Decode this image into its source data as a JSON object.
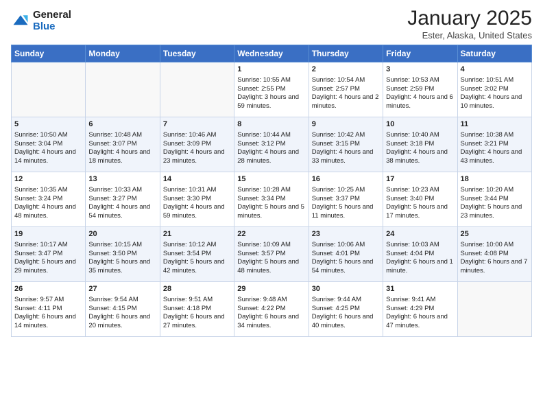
{
  "header": {
    "logo_general": "General",
    "logo_blue": "Blue",
    "title": "January 2025",
    "subtitle": "Ester, Alaska, United States"
  },
  "days_of_week": [
    "Sunday",
    "Monday",
    "Tuesday",
    "Wednesday",
    "Thursday",
    "Friday",
    "Saturday"
  ],
  "weeks": [
    [
      {
        "day": "",
        "info": ""
      },
      {
        "day": "",
        "info": ""
      },
      {
        "day": "",
        "info": ""
      },
      {
        "day": "1",
        "info": "Sunrise: 10:55 AM\nSunset: 2:55 PM\nDaylight: 3 hours and 59 minutes."
      },
      {
        "day": "2",
        "info": "Sunrise: 10:54 AM\nSunset: 2:57 PM\nDaylight: 4 hours and 2 minutes."
      },
      {
        "day": "3",
        "info": "Sunrise: 10:53 AM\nSunset: 2:59 PM\nDaylight: 4 hours and 6 minutes."
      },
      {
        "day": "4",
        "info": "Sunrise: 10:51 AM\nSunset: 3:02 PM\nDaylight: 4 hours and 10 minutes."
      }
    ],
    [
      {
        "day": "5",
        "info": "Sunrise: 10:50 AM\nSunset: 3:04 PM\nDaylight: 4 hours and 14 minutes."
      },
      {
        "day": "6",
        "info": "Sunrise: 10:48 AM\nSunset: 3:07 PM\nDaylight: 4 hours and 18 minutes."
      },
      {
        "day": "7",
        "info": "Sunrise: 10:46 AM\nSunset: 3:09 PM\nDaylight: 4 hours and 23 minutes."
      },
      {
        "day": "8",
        "info": "Sunrise: 10:44 AM\nSunset: 3:12 PM\nDaylight: 4 hours and 28 minutes."
      },
      {
        "day": "9",
        "info": "Sunrise: 10:42 AM\nSunset: 3:15 PM\nDaylight: 4 hours and 33 minutes."
      },
      {
        "day": "10",
        "info": "Sunrise: 10:40 AM\nSunset: 3:18 PM\nDaylight: 4 hours and 38 minutes."
      },
      {
        "day": "11",
        "info": "Sunrise: 10:38 AM\nSunset: 3:21 PM\nDaylight: 4 hours and 43 minutes."
      }
    ],
    [
      {
        "day": "12",
        "info": "Sunrise: 10:35 AM\nSunset: 3:24 PM\nDaylight: 4 hours and 48 minutes."
      },
      {
        "day": "13",
        "info": "Sunrise: 10:33 AM\nSunset: 3:27 PM\nDaylight: 4 hours and 54 minutes."
      },
      {
        "day": "14",
        "info": "Sunrise: 10:31 AM\nSunset: 3:30 PM\nDaylight: 4 hours and 59 minutes."
      },
      {
        "day": "15",
        "info": "Sunrise: 10:28 AM\nSunset: 3:34 PM\nDaylight: 5 hours and 5 minutes."
      },
      {
        "day": "16",
        "info": "Sunrise: 10:25 AM\nSunset: 3:37 PM\nDaylight: 5 hours and 11 minutes."
      },
      {
        "day": "17",
        "info": "Sunrise: 10:23 AM\nSunset: 3:40 PM\nDaylight: 5 hours and 17 minutes."
      },
      {
        "day": "18",
        "info": "Sunrise: 10:20 AM\nSunset: 3:44 PM\nDaylight: 5 hours and 23 minutes."
      }
    ],
    [
      {
        "day": "19",
        "info": "Sunrise: 10:17 AM\nSunset: 3:47 PM\nDaylight: 5 hours and 29 minutes."
      },
      {
        "day": "20",
        "info": "Sunrise: 10:15 AM\nSunset: 3:50 PM\nDaylight: 5 hours and 35 minutes."
      },
      {
        "day": "21",
        "info": "Sunrise: 10:12 AM\nSunset: 3:54 PM\nDaylight: 5 hours and 42 minutes."
      },
      {
        "day": "22",
        "info": "Sunrise: 10:09 AM\nSunset: 3:57 PM\nDaylight: 5 hours and 48 minutes."
      },
      {
        "day": "23",
        "info": "Sunrise: 10:06 AM\nSunset: 4:01 PM\nDaylight: 5 hours and 54 minutes."
      },
      {
        "day": "24",
        "info": "Sunrise: 10:03 AM\nSunset: 4:04 PM\nDaylight: 6 hours and 1 minute."
      },
      {
        "day": "25",
        "info": "Sunrise: 10:00 AM\nSunset: 4:08 PM\nDaylight: 6 hours and 7 minutes."
      }
    ],
    [
      {
        "day": "26",
        "info": "Sunrise: 9:57 AM\nSunset: 4:11 PM\nDaylight: 6 hours and 14 minutes."
      },
      {
        "day": "27",
        "info": "Sunrise: 9:54 AM\nSunset: 4:15 PM\nDaylight: 6 hours and 20 minutes."
      },
      {
        "day": "28",
        "info": "Sunrise: 9:51 AM\nSunset: 4:18 PM\nDaylight: 6 hours and 27 minutes."
      },
      {
        "day": "29",
        "info": "Sunrise: 9:48 AM\nSunset: 4:22 PM\nDaylight: 6 hours and 34 minutes."
      },
      {
        "day": "30",
        "info": "Sunrise: 9:44 AM\nSunset: 4:25 PM\nDaylight: 6 hours and 40 minutes."
      },
      {
        "day": "31",
        "info": "Sunrise: 9:41 AM\nSunset: 4:29 PM\nDaylight: 6 hours and 47 minutes."
      },
      {
        "day": "",
        "info": ""
      }
    ]
  ]
}
